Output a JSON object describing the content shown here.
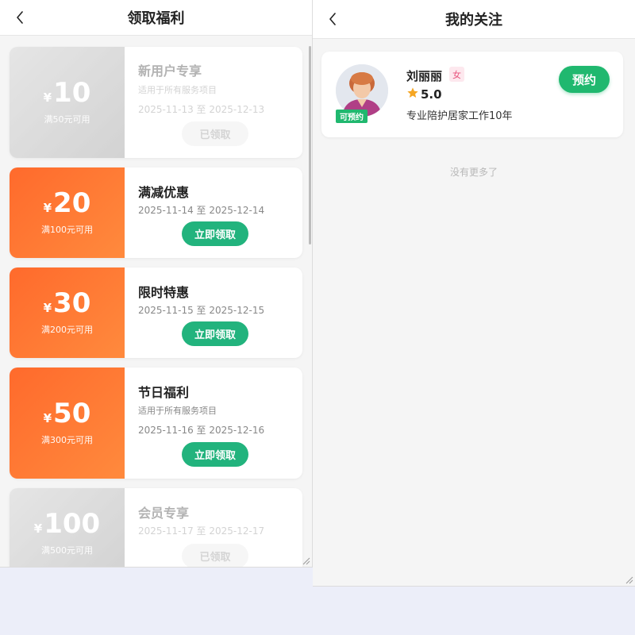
{
  "left_page": {
    "title": "领取福利",
    "coupons": [
      {
        "currency": "¥",
        "amount": "10",
        "condition": "满50元可用",
        "name": "新用户专享",
        "scope": "适用于所有服务项目",
        "date": "2025-11-13 至 2025-12-13",
        "button": "已领取",
        "state": "claimed"
      },
      {
        "currency": "¥",
        "amount": "20",
        "condition": "满100元可用",
        "name": "满减优惠",
        "scope": "",
        "date": "2025-11-14 至 2025-12-14",
        "button": "立即领取",
        "state": "active"
      },
      {
        "currency": "¥",
        "amount": "30",
        "condition": "满200元可用",
        "name": "限时特惠",
        "scope": "",
        "date": "2025-11-15 至 2025-12-15",
        "button": "立即领取",
        "state": "active"
      },
      {
        "currency": "¥",
        "amount": "50",
        "condition": "满300元可用",
        "name": "节日福利",
        "scope": "适用于所有服务项目",
        "date": "2025-11-16 至 2025-12-16",
        "button": "立即领取",
        "state": "active"
      },
      {
        "currency": "¥",
        "amount": "100",
        "condition": "满500元可用",
        "name": "会员专享",
        "scope": "",
        "date": "2025-11-17 至 2025-12-17",
        "button": "已领取",
        "state": "claimed"
      }
    ]
  },
  "right_page": {
    "title": "我的关注",
    "caregiver": {
      "name": "刘丽丽",
      "gender": "女",
      "rating": "5.0",
      "description": "专业陪护居家工作10年",
      "badge": "可预约",
      "book_label": "预约"
    },
    "footer_text": "没有更多了"
  },
  "colors": {
    "accent_green": "#22b37d",
    "coupon_orange": "#ff6a2c",
    "claimed_gray": "#bbbbbb",
    "star": "#f5a623",
    "backdrop": "#eceef9"
  },
  "icons": {
    "back": "chevron-left-icon",
    "rating": "star-icon",
    "resize": "resize-grip-icon"
  }
}
